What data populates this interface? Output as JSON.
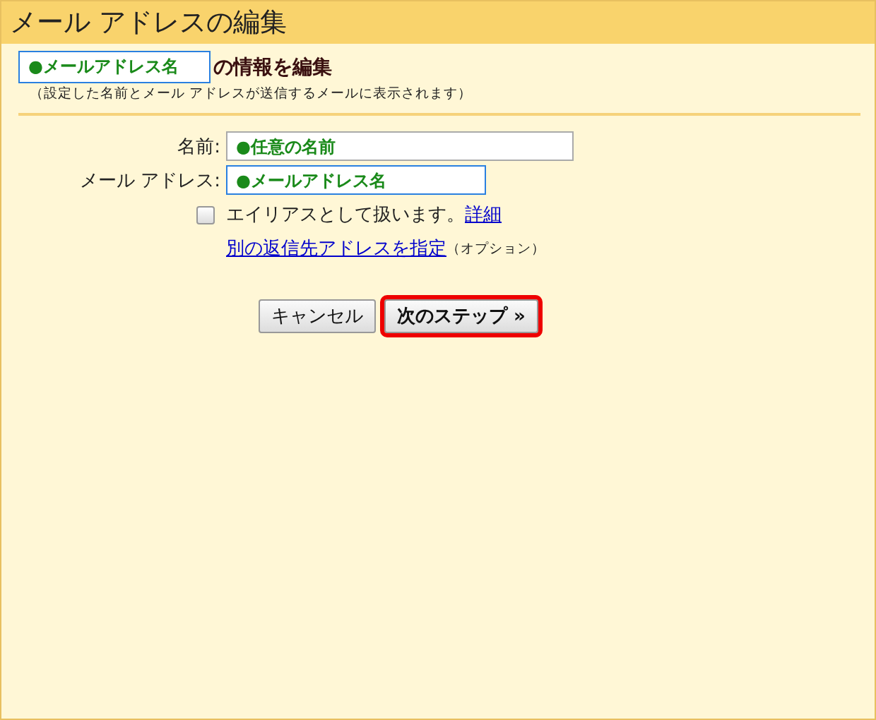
{
  "window": {
    "title": "メール アドレスの編集"
  },
  "heading": {
    "name_box": "●メールアドレス名",
    "text": "の情報を編集",
    "note": "（設定した名前とメール アドレスが送信するメールに表示されます）"
  },
  "fields": [
    {
      "label": "名前:",
      "value": "●任意の名前",
      "focused": false
    },
    {
      "label": "メール アドレス:",
      "value": "●メールアドレス名",
      "focused": true
    }
  ],
  "alias": {
    "label": "エイリアスとして扱います。",
    "checked": false,
    "link": "詳細"
  },
  "reply_to": {
    "link": "別の返信先アドレスを指定",
    "note": "（オプション）"
  },
  "buttons": [
    {
      "label": "キャンセル",
      "kind": "cancel",
      "highlighted": false
    },
    {
      "label": "次のステップ »",
      "kind": "next",
      "highlighted": true
    }
  ]
}
